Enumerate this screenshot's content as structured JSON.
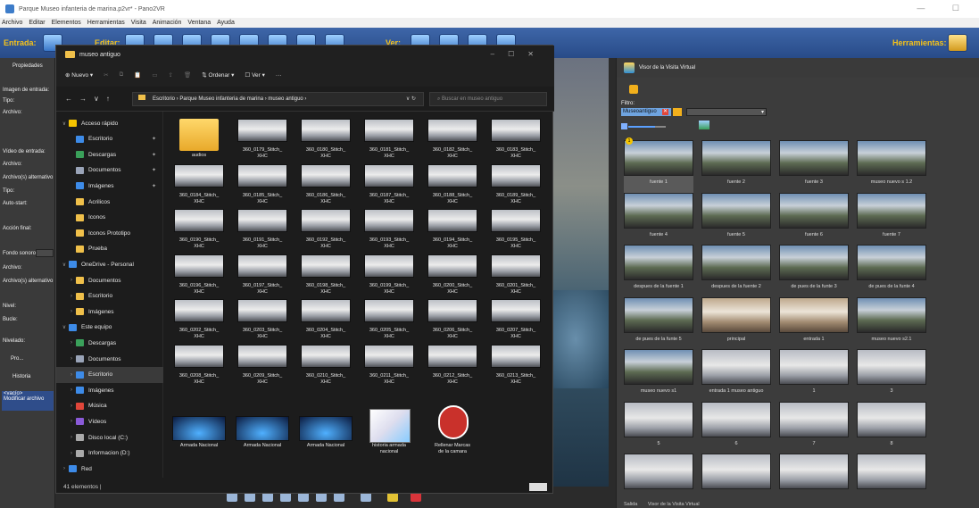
{
  "window": {
    "title": "Parque Museo infanteria de marina.p2vr* - Pano2VR",
    "controls": "—  ☐"
  },
  "menu": [
    "Archivo",
    "Editar",
    "Elementos",
    "Herramientas",
    "Visita",
    "Animación",
    "Ventana",
    "Ayuda"
  ],
  "toolbar": {
    "input_label": "Entrada:",
    "edit_label": "Editar:",
    "view_label": "Ver:",
    "tools_label": "Herramientas:"
  },
  "left_panel": {
    "properties_label": "Propiedades",
    "fields": [
      "Imagen de entrada:",
      "Tipo:",
      "Archivo:",
      "Vídeo de entrada:",
      "Archivo:",
      "Archivo(s) alternativo",
      "Tipo:",
      "Auto-start:",
      "Acción final:",
      "Fondo sonoro:",
      "Archivo:",
      "Archivo(s) alternativo",
      "Nivel:",
      "Bucle:",
      "Nivelado:"
    ],
    "pro_tab": "Pro...",
    "history_label": "Historia",
    "history_items": [
      "<vacío>",
      "Modificar archivo"
    ]
  },
  "explorer": {
    "title": "museo antiguo",
    "cmd": {
      "new": "Nuevo",
      "sort": "Ordenar",
      "view": "Ver",
      "more": "···"
    },
    "path": "Escritorio  ›  Parque Museo infanteria de marina  ›  museo antiguo  ›",
    "search_placeholder": "Buscar en museo antiguo",
    "nav": [
      {
        "label": "Acceso rápido",
        "icon": "star-icon",
        "level": 0,
        "chev": "∨",
        "color": "#f5c400"
      },
      {
        "label": "Escritorio",
        "icon": "desktop-icon",
        "level": 1,
        "pin": "📌",
        "color": "#3d8be8"
      },
      {
        "label": "Descargas",
        "icon": "download-icon",
        "level": 1,
        "pin": "📌",
        "color": "#3aa05a"
      },
      {
        "label": "Documentos",
        "icon": "documents-icon",
        "level": 1,
        "pin": "📌",
        "color": "#9aa4b8"
      },
      {
        "label": "Imágenes",
        "icon": "images-icon",
        "level": 1,
        "pin": "📌",
        "color": "#3d8be8"
      },
      {
        "label": "Acrilicos",
        "icon": "folder-icon",
        "level": 1,
        "color": "#f0c04a"
      },
      {
        "label": "Iconos",
        "icon": "folder-icon",
        "level": 1,
        "color": "#f0c04a"
      },
      {
        "label": "Iconos Prototipo",
        "icon": "folder-icon",
        "level": 1,
        "color": "#f0c04a"
      },
      {
        "label": "Prueba",
        "icon": "folder-icon",
        "level": 1,
        "color": "#f0c04a"
      },
      {
        "label": "OneDrive - Personal",
        "icon": "cloud-icon",
        "level": 0,
        "chev": "∨",
        "color": "#3d8be8"
      },
      {
        "label": "Documentos",
        "icon": "folder-icon",
        "level": 1,
        "chev": "›",
        "color": "#f0c04a"
      },
      {
        "label": "Escritorio",
        "icon": "folder-icon",
        "level": 1,
        "chev": "›",
        "color": "#f0c04a"
      },
      {
        "label": "Imágenes",
        "icon": "folder-icon",
        "level": 1,
        "chev": "›",
        "color": "#f0c04a"
      },
      {
        "label": "Este equipo",
        "icon": "computer-icon",
        "level": 0,
        "chev": "∨",
        "color": "#3d8be8"
      },
      {
        "label": "Descargas",
        "icon": "download-icon",
        "level": 1,
        "chev": "›",
        "color": "#3aa05a"
      },
      {
        "label": "Documentos",
        "icon": "documents-icon",
        "level": 1,
        "chev": "›",
        "color": "#9aa4b8"
      },
      {
        "label": "Escritorio",
        "icon": "desktop-icon",
        "level": 1,
        "chev": "›",
        "color": "#3d8be8",
        "selected": true
      },
      {
        "label": "Imágenes",
        "icon": "images-icon",
        "level": 1,
        "chev": "›",
        "color": "#3d8be8"
      },
      {
        "label": "Música",
        "icon": "music-icon",
        "level": 1,
        "chev": "›",
        "color": "#e0463a"
      },
      {
        "label": "Vídeos",
        "icon": "video-icon",
        "level": 1,
        "chev": "›",
        "color": "#8a5ad8"
      },
      {
        "label": "Disco local (C:)",
        "icon": "drive-icon",
        "level": 1,
        "chev": "›",
        "color": "#aaa"
      },
      {
        "label": "Informacion (D:)",
        "icon": "drive-icon",
        "level": 1,
        "chev": "›",
        "color": "#aaa"
      },
      {
        "label": "Red",
        "icon": "network-icon",
        "level": 0,
        "chev": "›",
        "color": "#3d8be8"
      }
    ],
    "files": [
      {
        "name": "audios",
        "type": "folder"
      },
      {
        "name": "360_0179_Stitch_\nXHC",
        "type": "pano"
      },
      {
        "name": "360_0180_Stitch_\nXHC",
        "type": "pano"
      },
      {
        "name": "360_0181_Stitch_\nXHC",
        "type": "pano"
      },
      {
        "name": "360_0182_Stitch_\nXHC",
        "type": "pano"
      },
      {
        "name": "360_0183_Stitch_\nXHC",
        "type": "pano"
      },
      {
        "name": "360_0184_Stitch_\nXHC",
        "type": "pano"
      },
      {
        "name": "360_0185_Stitch_\nXHC",
        "type": "pano"
      },
      {
        "name": "360_0186_Stitch_\nXHC",
        "type": "pano"
      },
      {
        "name": "360_0187_Stitch_\nXHC",
        "type": "pano"
      },
      {
        "name": "360_0188_Stitch_\nXHC",
        "type": "pano"
      },
      {
        "name": "360_0189_Stitch_\nXHC",
        "type": "pano"
      },
      {
        "name": "360_0190_Stitch_\nXHC",
        "type": "pano"
      },
      {
        "name": "360_0191_Stitch_\nXHC",
        "type": "pano"
      },
      {
        "name": "360_0192_Stitch_\nXHC",
        "type": "pano"
      },
      {
        "name": "360_0193_Stitch_\nXHC",
        "type": "pano"
      },
      {
        "name": "360_0194_Stitch_\nXHC",
        "type": "pano"
      },
      {
        "name": "360_0195_Stitch_\nXHC",
        "type": "pano"
      },
      {
        "name": "360_0196_Stitch_\nXHC",
        "type": "pano"
      },
      {
        "name": "360_0197_Stitch_\nXHC",
        "type": "pano"
      },
      {
        "name": "360_0198_Stitch_\nXHC",
        "type": "pano"
      },
      {
        "name": "360_0199_Stitch_\nXHC",
        "type": "pano"
      },
      {
        "name": "360_0200_Stitch_\nXHC",
        "type": "pano"
      },
      {
        "name": "360_0201_Stitch_\nXHC",
        "type": "pano"
      },
      {
        "name": "360_0202_Stitch_\nXHC",
        "type": "pano"
      },
      {
        "name": "360_0203_Stitch_\nXHC",
        "type": "pano"
      },
      {
        "name": "360_0204_Stitch_\nXHC",
        "type": "pano"
      },
      {
        "name": "360_0205_Stitch_\nXHC",
        "type": "pano"
      },
      {
        "name": "360_0206_Stitch_\nXHC",
        "type": "pano"
      },
      {
        "name": "360_0207_Stitch_\nXHC",
        "type": "pano"
      },
      {
        "name": "360_0208_Stitch_\nXHC",
        "type": "pano"
      },
      {
        "name": "360_0209_Stitch_\nXHC",
        "type": "pano"
      },
      {
        "name": "360_0210_Stitch_\nXHC",
        "type": "pano"
      },
      {
        "name": "360_0211_Stitch_\nXHC",
        "type": "pano"
      },
      {
        "name": "360_0212_Stitch_\nXHC",
        "type": "pano"
      },
      {
        "name": "360_0213_Stitch_\nXHC",
        "type": "pano"
      },
      {
        "name": "Armada Nacional",
        "type": "video"
      },
      {
        "name": "Armada Nacional",
        "type": "video"
      },
      {
        "name": "Armada Nacional",
        "type": "video"
      },
      {
        "name": "historia armada\nnacional",
        "type": "paper"
      },
      {
        "name": "Rellenar Marcas\nde la camara",
        "type": "seal"
      }
    ],
    "status": "41 elementos  |"
  },
  "tour_browser": {
    "title": "Visor de la Visita Virtual",
    "filter_label": "Filtro:",
    "filter_tag": "Museoantiguo",
    "nodes": [
      {
        "label": "fuente 1",
        "kind": "outdoor",
        "selected": true,
        "badge": "1"
      },
      {
        "label": "fuente 2",
        "kind": "outdoor"
      },
      {
        "label": "fuente 3",
        "kind": "outdoor"
      },
      {
        "label": "museo nuevo s 1.2",
        "kind": "outdoor"
      },
      {
        "label": "fuente 4",
        "kind": "outdoor"
      },
      {
        "label": "fuente 5",
        "kind": "outdoor"
      },
      {
        "label": "fuente 6",
        "kind": "outdoor"
      },
      {
        "label": "fuente 7",
        "kind": "outdoor"
      },
      {
        "label": "despues de la fuente 1",
        "kind": "outdoor"
      },
      {
        "label": "despues de la fuente 2",
        "kind": "outdoor"
      },
      {
        "label": "de pues de la funte 3",
        "kind": "outdoor"
      },
      {
        "label": "de pues de la funte 4",
        "kind": "outdoor"
      },
      {
        "label": "de pues de la funte  5",
        "kind": "outdoor"
      },
      {
        "label": "principal",
        "kind": "indoor"
      },
      {
        "label": "entrada 1",
        "kind": "indoor"
      },
      {
        "label": "museo nuevo s2.1",
        "kind": "outdoor"
      },
      {
        "label": "museo nuevo s1",
        "kind": "outdoor"
      },
      {
        "label": "entrada 1 museo antiguo",
        "kind": "hall"
      },
      {
        "label": "1",
        "kind": "hall"
      },
      {
        "label": "3",
        "kind": "hall"
      },
      {
        "label": "5",
        "kind": "hall"
      },
      {
        "label": "6",
        "kind": "hall"
      },
      {
        "label": "7",
        "kind": "hall"
      },
      {
        "label": "8",
        "kind": "hall"
      },
      {
        "label": "",
        "kind": "hall"
      },
      {
        "label": "",
        "kind": "hall"
      },
      {
        "label": "",
        "kind": "hall"
      },
      {
        "label": "",
        "kind": "hall"
      }
    ],
    "status_left": "Salida",
    "status_right": "Visor de la Visita Virtual"
  }
}
